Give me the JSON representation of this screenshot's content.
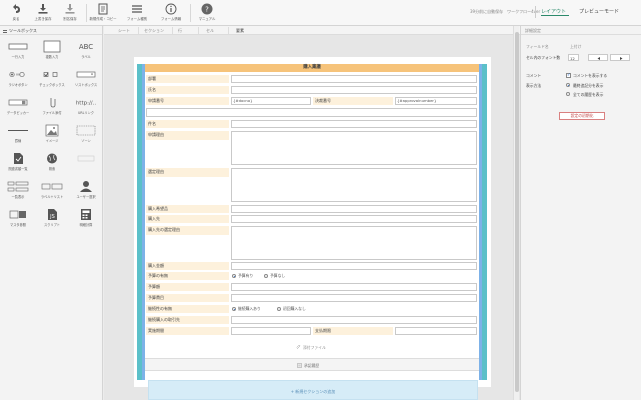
{
  "toolbar": {
    "buttons": [
      {
        "label": "戻る",
        "icon": "undo-icon"
      },
      {
        "label": "上書き保存",
        "icon": "save-icon"
      },
      {
        "label": "別名保存",
        "icon": "save-as-icon"
      },
      {
        "label": "新規作成・コピー",
        "icon": "new-copy-icon"
      },
      {
        "label": "フォーム種別",
        "icon": "form-type-icon"
      },
      {
        "label": "フォーム情報",
        "icon": "info-icon"
      },
      {
        "label": "マニュアル",
        "icon": "help-icon"
      }
    ],
    "status": "39分前に自動保存　ワークフロー4ver",
    "layout_label": "レイアウト",
    "preview_label": "プレビューモード"
  },
  "toolbox": {
    "title": "ツールボックス",
    "items": [
      {
        "label": "一行入力"
      },
      {
        "label": "複数入力"
      },
      {
        "label": "ラベル"
      },
      {
        "label": "ラジオボタン"
      },
      {
        "label": "チェックボックス"
      },
      {
        "label": "リストボックス"
      },
      {
        "label": "データピッカー"
      },
      {
        "label": "ファイル添付"
      },
      {
        "label": "URLリンク"
      },
      {
        "label": "罫線"
      },
      {
        "label": "イメージ"
      },
      {
        "label": "ゾーン"
      },
      {
        "label": "関連書類一覧"
      },
      {
        "label": "検索"
      },
      {
        "label": ""
      },
      {
        "label": "一覧表示"
      },
      {
        "label": "ラベル＋リスト"
      },
      {
        "label": "ユーザー選択"
      },
      {
        "label": "マスタ参照"
      },
      {
        "label": "スクリプト"
      },
      {
        "label": "明細計算"
      }
    ]
  },
  "breadcrumb": [
    "シート",
    "セクション",
    "行",
    "セル",
    "要素"
  ],
  "form": {
    "title": "購入稟議",
    "labels": {
      "dept": "部署",
      "name": "氏名",
      "apply_no": "申請番号",
      "apply_no_value": "{#docno}",
      "case_no": "決裁番号",
      "case_no_value": "{#approvalnumber}",
      "title": "件名",
      "reason": "申請理由",
      "selection_reason": "選定理由",
      "items": "購入希望品",
      "vendor": "購入先",
      "vendor_reason": "購入先の選定理由",
      "amount": "購入金額",
      "budget_flag": "予算の有無",
      "budget_yes": "予算有り",
      "budget_no": "予算なし",
      "budget_amount": "予算額",
      "budget_subject": "予算費目",
      "contract_flag": "継続性の有無",
      "contract_yes": "継続購入あり",
      "contract_no": "初回購入なし",
      "contract_vendor": "継続購入の取引先",
      "period": "実施期間",
      "payment_due": "支払期限"
    },
    "attach_label": "添付ファイル",
    "approval_label": "承認履歴",
    "add_section_label": "+ 新規セクションの追加"
  },
  "panel": {
    "title": "詳細設定",
    "field_name_label": "フィールド名",
    "field_name_value": "上付け",
    "font_size_label": "セル内のフォント数",
    "font_size_value": "12",
    "comment_label": "コメント",
    "comment_check": "コメントを表示する",
    "display_label": "表示方法",
    "display_opt1": "最終追記分を表示",
    "display_opt2": "全ての履歴を表示",
    "reset_label": "設定の初期化"
  }
}
